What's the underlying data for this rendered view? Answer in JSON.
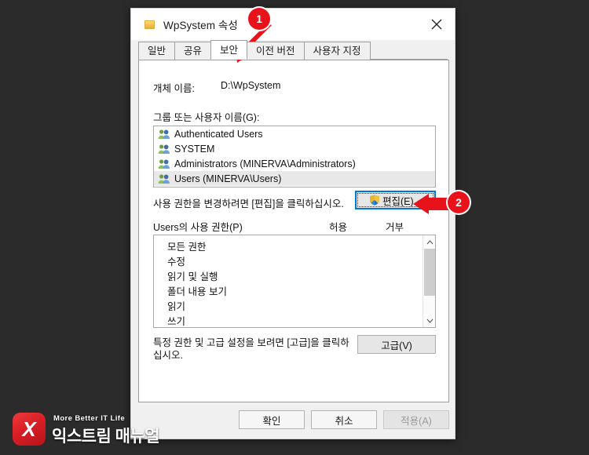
{
  "window": {
    "title": "WpSystem 속성",
    "folder_icon": "folder-icon",
    "close_icon": "close-icon"
  },
  "tabs": [
    {
      "label": "일반",
      "active": false
    },
    {
      "label": "공유",
      "active": false
    },
    {
      "label": "보안",
      "active": true
    },
    {
      "label": "이전 버전",
      "active": false
    },
    {
      "label": "사용자 지정",
      "active": false
    }
  ],
  "security": {
    "object_name_label": "개체 이름:",
    "object_name_value": "D:\\WpSystem",
    "groups_label": "그룹 또는 사용자 이름(G):",
    "groups": [
      {
        "name": "Authenticated Users",
        "selected": false
      },
      {
        "name": "SYSTEM",
        "selected": false
      },
      {
        "name": "Administrators (MINERVA\\Administrators)",
        "selected": false
      },
      {
        "name": "Users (MINERVA\\Users)",
        "selected": true
      }
    ],
    "edit_hint": "사용 권한을 변경하려면 [편집]을 클릭하십시오.",
    "edit_button": "편집(E)...",
    "edit_button_icon": "uac-shield-icon",
    "permissions_label": "Users의 사용 권한(P)",
    "col_allow": "허용",
    "col_deny": "거부",
    "permissions": [
      "모든 권한",
      "수정",
      "읽기 및 실행",
      "폴더 내용 보기",
      "읽기",
      "쓰기"
    ],
    "advanced_hint": "특정 권한 및 고급 설정을 보려면 [고급]을 클릭하십시오.",
    "advanced_button": "고급(V)"
  },
  "footer": {
    "ok": "확인",
    "cancel": "취소",
    "apply": "적용(A)",
    "apply_disabled": true
  },
  "annotations": [
    {
      "id": "1",
      "label": "1",
      "target": "tab-보안"
    },
    {
      "id": "2",
      "label": "2",
      "target": "edit-button"
    }
  ],
  "watermark": {
    "mark": "X",
    "tagline": "More Better IT Life",
    "name": "익스트림 매뉴얼"
  },
  "colors": {
    "accent": "#0078d7",
    "annotation": "#e8121b",
    "background": "#2b2b2b",
    "dialog": "#f0f0f0"
  }
}
